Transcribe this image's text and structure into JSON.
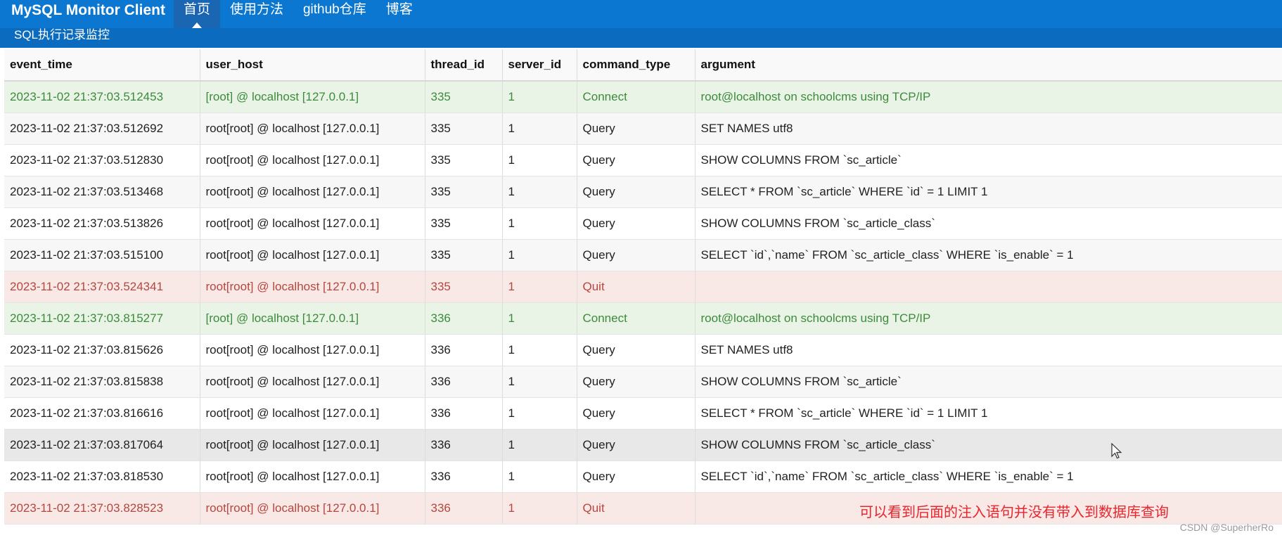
{
  "app": {
    "title": "MySQL Monitor Client",
    "nav": [
      {
        "label": "首页",
        "active": true
      },
      {
        "label": "使用方法",
        "active": false
      },
      {
        "label": "github仓库",
        "active": false
      },
      {
        "label": "博客",
        "active": false
      }
    ],
    "subtitle": "SQL执行记录监控"
  },
  "table": {
    "columns": [
      "event_time",
      "user_host",
      "thread_id",
      "server_id",
      "command_type",
      "argument"
    ],
    "rows": [
      {
        "status": "success",
        "cells": [
          "2023-11-02 21:37:03.512453",
          "[root] @ localhost [127.0.0.1]",
          "335",
          "1",
          "Connect",
          "root@localhost on schoolcms using TCP/IP"
        ]
      },
      {
        "status": "plain",
        "cells": [
          "2023-11-02 21:37:03.512692",
          "root[root] @ localhost [127.0.0.1]",
          "335",
          "1",
          "Query",
          "SET NAMES utf8"
        ]
      },
      {
        "status": "plain",
        "cells": [
          "2023-11-02 21:37:03.512830",
          "root[root] @ localhost [127.0.0.1]",
          "335",
          "1",
          "Query",
          "SHOW COLUMNS FROM `sc_article`"
        ]
      },
      {
        "status": "plain",
        "cells": [
          "2023-11-02 21:37:03.513468",
          "root[root] @ localhost [127.0.0.1]",
          "335",
          "1",
          "Query",
          "SELECT * FROM `sc_article` WHERE `id` = 1 LIMIT 1"
        ]
      },
      {
        "status": "plain",
        "cells": [
          "2023-11-02 21:37:03.513826",
          "root[root] @ localhost [127.0.0.1]",
          "335",
          "1",
          "Query",
          "SHOW COLUMNS FROM `sc_article_class`"
        ]
      },
      {
        "status": "plain",
        "cells": [
          "2023-11-02 21:37:03.515100",
          "root[root] @ localhost [127.0.0.1]",
          "335",
          "1",
          "Query",
          "SELECT `id`,`name` FROM `sc_article_class` WHERE `is_enable` = 1"
        ]
      },
      {
        "status": "danger",
        "cells": [
          "2023-11-02 21:37:03.524341",
          "root[root] @ localhost [127.0.0.1]",
          "335",
          "1",
          "Quit",
          ""
        ]
      },
      {
        "status": "success",
        "cells": [
          "2023-11-02 21:37:03.815277",
          "[root] @ localhost [127.0.0.1]",
          "336",
          "1",
          "Connect",
          "root@localhost on schoolcms using TCP/IP"
        ]
      },
      {
        "status": "plain",
        "cells": [
          "2023-11-02 21:37:03.815626",
          "root[root] @ localhost [127.0.0.1]",
          "336",
          "1",
          "Query",
          "SET NAMES utf8"
        ]
      },
      {
        "status": "plain",
        "cells": [
          "2023-11-02 21:37:03.815838",
          "root[root] @ localhost [127.0.0.1]",
          "336",
          "1",
          "Query",
          "SHOW COLUMNS FROM `sc_article`"
        ]
      },
      {
        "status": "plain",
        "cells": [
          "2023-11-02 21:37:03.816616",
          "root[root] @ localhost [127.0.0.1]",
          "336",
          "1",
          "Query",
          "SELECT * FROM `sc_article` WHERE `id` = 1 LIMIT 1"
        ]
      },
      {
        "status": "hover",
        "cells": [
          "2023-11-02 21:37:03.817064",
          "root[root] @ localhost [127.0.0.1]",
          "336",
          "1",
          "Query",
          "SHOW COLUMNS FROM `sc_article_class`"
        ]
      },
      {
        "status": "plain",
        "cells": [
          "2023-11-02 21:37:03.818530",
          "root[root] @ localhost [127.0.0.1]",
          "336",
          "1",
          "Query",
          "SELECT `id`,`name` FROM `sc_article_class` WHERE `is_enable` = 1"
        ]
      },
      {
        "status": "danger",
        "cells": [
          "2023-11-02 21:37:03.828523",
          "root[root] @ localhost [127.0.0.1]",
          "336",
          "1",
          "Quit",
          ""
        ]
      }
    ]
  },
  "annotation": "可以看到后面的注入语句并没有带入到数据库查询",
  "watermark": "CSDN @SuperherRo",
  "colors": {
    "header_blue": "#0c77d1",
    "success_text": "#3c8b3c",
    "success_bg": "#eaf4e6",
    "danger_text": "#b5473f",
    "danger_bg": "#f8e8e6",
    "annotation_red": "#e8262e"
  }
}
